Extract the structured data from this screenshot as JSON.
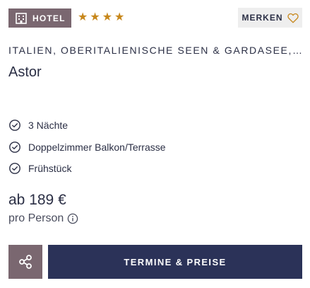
{
  "badge": {
    "label": "HOTEL",
    "icon": "hotel-building-icon"
  },
  "rating": {
    "stars": 4,
    "star_symbol": "★",
    "color": "#c7871b"
  },
  "merken": {
    "label": "MERKEN",
    "icon": "heart-outline-icon"
  },
  "hotel": {
    "region": "ITALIEN, OBERITALIENISCHE SEEN & GARDASEE, ...",
    "name": "Astor"
  },
  "features": [
    {
      "label": "3 Nächte",
      "icon": "check-circle-icon"
    },
    {
      "label": "Doppelzimmer Balkon/Terrasse",
      "icon": "check-circle-icon"
    },
    {
      "label": "Frühstück",
      "icon": "check-circle-icon"
    }
  ],
  "price": {
    "label": "ab 189 €",
    "per_person": "pro Person"
  },
  "actions": {
    "share_icon": "share-icon",
    "cta_label": "TERMINE & PREISE"
  },
  "colors": {
    "accent": "#7a6770",
    "primary": "#2b3258",
    "text": "#2b2f45",
    "merken_bg": "#eeeeee"
  }
}
